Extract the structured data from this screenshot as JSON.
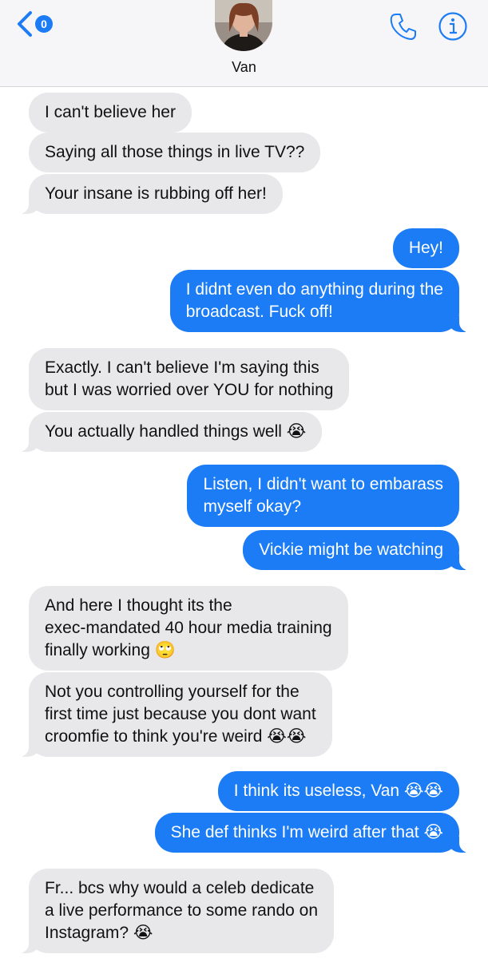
{
  "header": {
    "back_badge_count": "0",
    "contact_name": "Van",
    "back_icon": "chevron-left-icon",
    "call_icon": "phone-icon",
    "info_icon": "info-icon",
    "accent_color": "#1b7cf5"
  },
  "messages": [
    {
      "from": "them",
      "text": "I can't believe her"
    },
    {
      "from": "them",
      "text": "Saying all those things in live TV??"
    },
    {
      "from": "them",
      "text": "Your insane is rubbing off her!"
    },
    {
      "from": "me",
      "text": "Hey!"
    },
    {
      "from": "me",
      "text": "I didnt even do anything during the\nbroadcast. Fuck off!"
    },
    {
      "from": "them",
      "text": "Exactly. I can't believe I'm saying this\nbut I was worried over YOU for nothing"
    },
    {
      "from": "them",
      "text": "You actually handled things well 😭"
    },
    {
      "from": "me",
      "text": "Listen, I didn't want to embarass\nmyself okay?"
    },
    {
      "from": "me",
      "text": "Vickie might be watching"
    },
    {
      "from": "them",
      "text": "And here I thought its the\nexec-mandated 40 hour media training\nfinally working 🙄"
    },
    {
      "from": "them",
      "text": "Not you controlling yourself for the\nfirst time just because you dont want\ncroomfie to think you're weird 😭😭"
    },
    {
      "from": "me",
      "text": "I think its useless, Van 😭😭"
    },
    {
      "from": "me",
      "text": "She def thinks I'm weird after that 😭"
    },
    {
      "from": "them",
      "text": "Fr... bcs why would a celeb dedicate\na live performance to some rando on\nInstagram? 😭"
    }
  ]
}
